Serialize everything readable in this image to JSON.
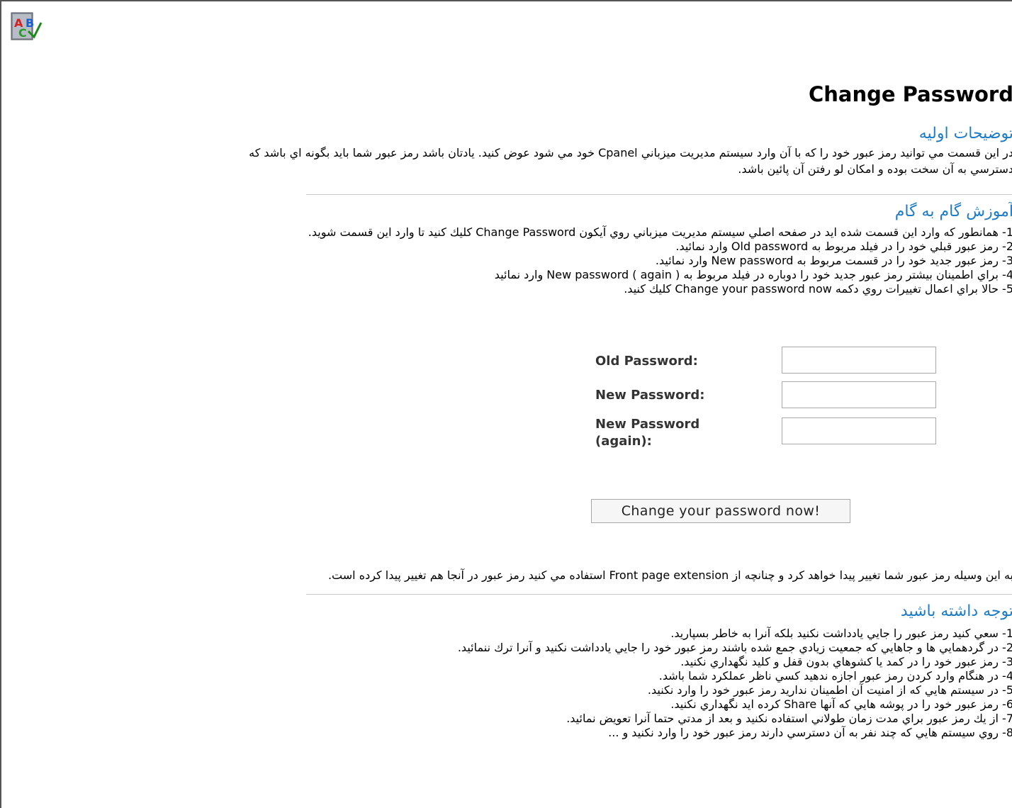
{
  "page": {
    "title": "Change Password"
  },
  "intro": {
    "heading": "توضيحات اوليه",
    "line1": "در اين قسمت مي توانيد رمز عبور خود را كه با آن وارد سيستم مديريت ميزباني Cpanel خود مي شود عوض كنيد. يادتان باشد رمز عبور شما بايد بگونه اي باشد كه",
    "line2": "دسترسي به آن سخت بوده و امكان لو رفتن آن پائين باشد."
  },
  "steps": {
    "heading": "آموزش گام به گام",
    "items": [
      "1- همانطور كه وارد اين قسمت شده ايد در صفحه اصلي سيستم مديريت ميزباني روي آيكون Change Password كليك كنيد تا وارد اين قسمت شويد.",
      "2- رمز عبور قبلي خود را در فيلد مربوط به Old password وارد نمائيد.",
      "3- رمز عبور جديد خود را در قسمت مربوط به New password وارد نمائيد.",
      "4- براي اطمينان بيشتر رمز عبور جديد خود را دوباره در فيلد مربوط به ( again ) New password  وارد نمائيد",
      "5- حالا براي اعمال تغييرات روي دكمه Change your password now كليك كنيد."
    ]
  },
  "form": {
    "old_password_label": "Old Password:",
    "new_password_label": "New Password:",
    "new_password_again_label_1": "New Password",
    "new_password_again_label_2": "(again):",
    "submit_label": "Change your password now!"
  },
  "result_note": "به اين وسيله رمز عبور شما تغيير پيدا خواهد كرد و چنانچه از Front page extension استفاده مي كنيد رمز عبور در آنجا هم تغيير پيدا كرده است.",
  "tips": {
    "heading": "توجه داشته باشيد",
    "items": [
      "1- سعي كنيد رمز عبور را جايي يادداشت نكنيد بلكه آنرا به خاطر بسپاريد.",
      "2- در گردهمايي ها و جاهايي كه جمعيت زيادي جمع شده باشند رمز عبور خود را جايي يادداشت نكنيد و آنرا ترك ننمائيد.",
      "3- رمز عبور خود را در كمد يا كشوهاي بدون قفل و كليد نگهداري نكنيد.",
      "4- در هنگام وارد كردن رمز عبور اجازه ندهيد كسي ناظر عملكرد شما باشد.",
      "5- در سيستم هايي كه از امنيت آن اطمينان نداريد رمز عبور خود را وارد نكنيد.",
      "6- رمز عبور خود را در پوشه هايي كه آنها Share كرده ايد نگهداري نكنيد.",
      "7- از يك رمز عبور براي مدت زمان طولاني استفاده نكنيد و بعد از مدتي حتما آنرا تعويض نمائيد.",
      "8- روي سيستم هايي كه چند نفر به آن دسترسي دارند رمز عبور خود را وارد نكنيد و ..."
    ]
  },
  "icons": {
    "app_icon": "spellcheck-abc-icon"
  }
}
